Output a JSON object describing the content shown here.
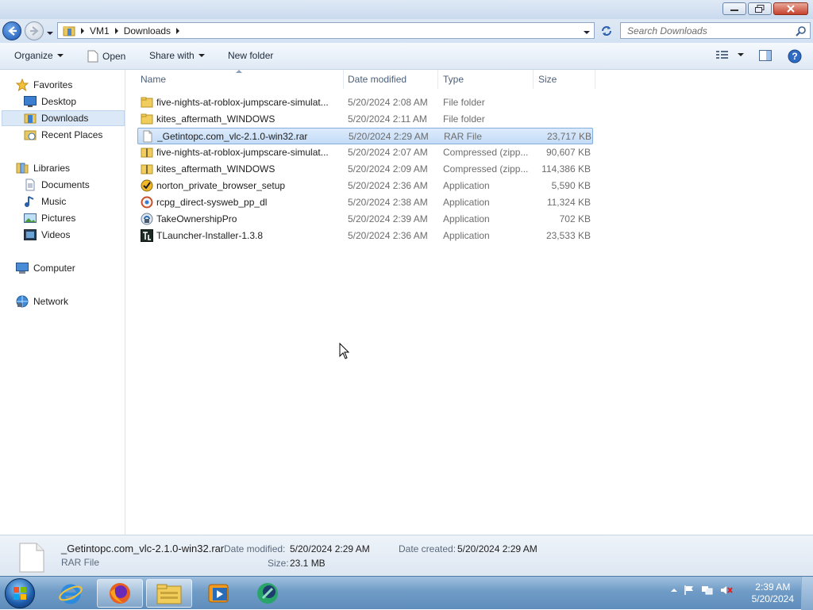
{
  "address": {
    "segments": [
      "VM1",
      "Downloads"
    ]
  },
  "search": {
    "placeholder": "Search Downloads"
  },
  "toolbar": {
    "organize_label": "Organize",
    "open_label": "Open",
    "share_label": "Share with",
    "newfolder_label": "New folder"
  },
  "nav": {
    "favorites": "Favorites",
    "desktop": "Desktop",
    "downloads": "Downloads",
    "recent": "Recent Places",
    "libraries": "Libraries",
    "documents": "Documents",
    "music": "Music",
    "pictures": "Pictures",
    "videos": "Videos",
    "computer": "Computer",
    "network": "Network"
  },
  "columns": {
    "name": "Name",
    "date": "Date modified",
    "type": "Type",
    "size": "Size"
  },
  "files": [
    {
      "name": "five-nights-at-roblox-jumpscare-simulat...",
      "date": "5/20/2024 2:08 AM",
      "type": "File folder",
      "size": "",
      "icon": "folder-icon"
    },
    {
      "name": "kites_aftermath_WINDOWS",
      "date": "5/20/2024 2:11 AM",
      "type": "File folder",
      "size": "",
      "icon": "folder-icon"
    },
    {
      "name": "_Getintopc.com_vlc-2.1.0-win32.rar",
      "date": "5/20/2024 2:29 AM",
      "type": "RAR File",
      "size": "23,717 KB",
      "icon": "file-icon"
    },
    {
      "name": "five-nights-at-roblox-jumpscare-simulat...",
      "date": "5/20/2024 2:07 AM",
      "type": "Compressed (zipp...",
      "size": "90,607 KB",
      "icon": "zip-folder-icon"
    },
    {
      "name": "kites_aftermath_WINDOWS",
      "date": "5/20/2024 2:09 AM",
      "type": "Compressed (zipp...",
      "size": "114,386 KB",
      "icon": "zip-folder-icon"
    },
    {
      "name": "norton_private_browser_setup",
      "date": "5/20/2024 2:36 AM",
      "type": "Application",
      "size": "5,590 KB",
      "icon": "norton-app-icon"
    },
    {
      "name": "rcpg_direct-sysweb_pp_dl",
      "date": "5/20/2024 2:38 AM",
      "type": "Application",
      "size": "11,324 KB",
      "icon": "installer-app-icon"
    },
    {
      "name": "TakeOwnershipPro",
      "date": "5/20/2024 2:39 AM",
      "type": "Application",
      "size": "702 KB",
      "icon": "takeownership-app-icon"
    },
    {
      "name": "TLauncher-Installer-1.3.8",
      "date": "5/20/2024 2:36 AM",
      "type": "Application",
      "size": "23,533 KB",
      "icon": "tlauncher-app-icon"
    }
  ],
  "details": {
    "filename": "_Getintopc.com_vlc-2.1.0-win32.rar",
    "filetype": "RAR File",
    "modified_label": "Date modified:",
    "modified_value": "5/20/2024 2:29 AM",
    "created_label": "Date created:",
    "created_value": "5/20/2024 2:29 AM",
    "size_label": "Size:",
    "size_value": "23.1 MB"
  },
  "clock": {
    "time": "2:39 AM",
    "date": "5/20/2024"
  },
  "colors": {
    "selection": "#cce4fc",
    "accent": "#1d57b4",
    "taskbar": "#6f9bc6"
  }
}
